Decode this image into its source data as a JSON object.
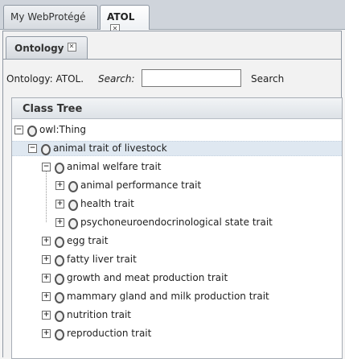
{
  "top_tabs": [
    {
      "label": "My WebProtégé",
      "active": false
    },
    {
      "label": "ATOL",
      "active": true,
      "close": "✕"
    }
  ],
  "sub_tabs": [
    {
      "label": "Ontology",
      "close": "✕"
    }
  ],
  "search_bar": {
    "ontology_label": "Ontology: ATOL.",
    "search_label": "Search:",
    "search_value": "",
    "search_placeholder": "",
    "search_button": "Search"
  },
  "class_tree": {
    "title": "Class Tree",
    "nodes": [
      {
        "label": "owl:Thing",
        "toggle": "−",
        "icon": "class-icon"
      },
      {
        "label": "animal trait of livestock",
        "toggle": "−",
        "icon": "class-icon",
        "selected": true
      },
      {
        "label": "animal welfare trait",
        "toggle": "−",
        "icon": "class-icon"
      },
      {
        "label": "animal performance trait",
        "toggle": "+",
        "icon": "class-icon"
      },
      {
        "label": "health trait",
        "toggle": "+",
        "icon": "class-icon"
      },
      {
        "label": "psychoneuroendocrinological state trait",
        "toggle": "+",
        "icon": "class-icon"
      },
      {
        "label": "egg trait",
        "toggle": "+",
        "icon": "class-icon"
      },
      {
        "label": "fatty liver trait",
        "toggle": "+",
        "icon": "class-icon"
      },
      {
        "label": "growth and meat production trait",
        "toggle": "+",
        "icon": "class-icon"
      },
      {
        "label": "mammary gland and milk production trait",
        "toggle": "+",
        "icon": "class-icon"
      },
      {
        "label": "nutrition trait",
        "toggle": "+",
        "icon": "class-icon"
      },
      {
        "label": "reproduction trait",
        "toggle": "+",
        "icon": "class-icon"
      }
    ]
  }
}
